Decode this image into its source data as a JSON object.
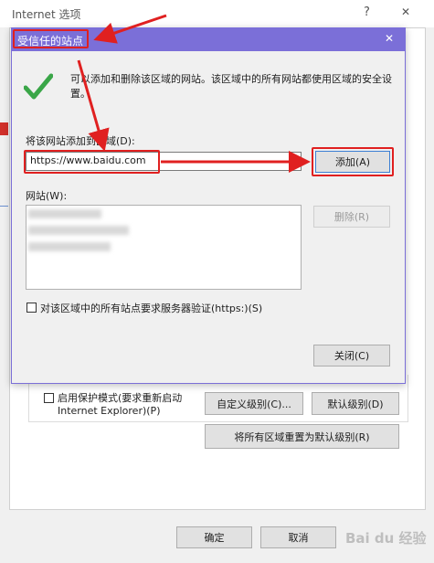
{
  "outer": {
    "title": "Internet 选项",
    "help_glyph": "?",
    "close_glyph": "✕",
    "protected_mode_line1": "启用保护模式(要求重新启动",
    "protected_mode_line2": "Internet Explorer)(P)",
    "custom_level_label": "自定义级别(C)...",
    "default_level_label": "默认级别(D)",
    "reset_all_label": "将所有区域重置为默认级别(R)",
    "ok_label": "确定",
    "cancel_label": "取消",
    "watermark": "Bai du 经验"
  },
  "dialog": {
    "title": "受信任的站点",
    "close_glyph": "✕",
    "info_text": "可以添加和删除该区域的网站。该区域中的所有网站都使用区域的安全设置。",
    "add_label": "将该网站添加到区域(D):",
    "url_value": "https://www.baidu.com",
    "add_button": "添加(A)",
    "sites_label": "网站(W):",
    "remove_button": "删除(R)",
    "verify_label": "对该区域中的所有站点要求服务器验证(https:)(S)",
    "close_button": "关闭(C)"
  },
  "colors": {
    "dialog_title_bg": "#7b6fd8",
    "annotation_red": "#e02020",
    "check_green": "#3aa648"
  }
}
